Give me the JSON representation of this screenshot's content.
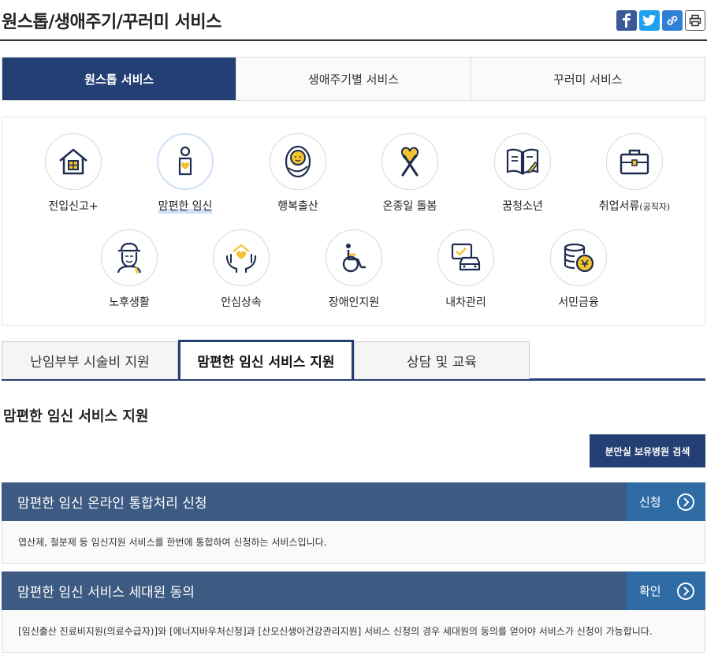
{
  "header": {
    "title": "원스톱/생애주기/꾸러미 서비스"
  },
  "share": [
    {
      "name": "facebook-icon",
      "cls": "fb"
    },
    {
      "name": "twitter-icon",
      "cls": "tw"
    },
    {
      "name": "link-icon",
      "cls": "lk"
    },
    {
      "name": "print-icon",
      "cls": "pr"
    }
  ],
  "main_tabs": [
    {
      "label": "원스톱 서비스",
      "active": true
    },
    {
      "label": "생애주기별 서비스",
      "active": false
    },
    {
      "label": "꾸러미 서비스",
      "active": false
    }
  ],
  "services": [
    {
      "label": "전입신고+",
      "icon": "house-icon"
    },
    {
      "label": "맘편한 임신",
      "icon": "pregnant-icon",
      "active": true
    },
    {
      "label": "행복출산",
      "icon": "baby-icon"
    },
    {
      "label": "온종일 돌봄",
      "icon": "ribbon-icon"
    },
    {
      "label": "꿈청소년",
      "icon": "book-icon"
    },
    {
      "label": "취업서류",
      "label_small": "(공직자)",
      "icon": "briefcase-icon"
    },
    {
      "label": "노후생활",
      "icon": "elder-icon"
    },
    {
      "label": "안심상속",
      "icon": "hands-heart-icon"
    },
    {
      "label": "장애인지원",
      "icon": "wheelchair-icon"
    },
    {
      "label": "내차관리",
      "icon": "car-icon"
    },
    {
      "label": "서민금융",
      "icon": "coins-icon"
    }
  ],
  "sub_tabs": [
    {
      "label": "난임부부 시술비 지원",
      "active": false
    },
    {
      "label": "맘편한 임신 서비스 지원",
      "active": true
    },
    {
      "label": "상담 및 교육",
      "active": false
    }
  ],
  "section": {
    "title": "맘편한 임신 서비스 지원",
    "search_button": "분만실 보유병원 검색"
  },
  "cards": [
    {
      "title": "맘편한 임신 온라인 통합처리 신청",
      "action": "신청",
      "desc": "엽산제, 철분제 등 임신지원 서비스를 한번에 통합하여 신청하는 서비스입니다."
    },
    {
      "title": "맘편한 임신 서비스 세대원 동의",
      "action": "확인",
      "desc": "[임신출산 진료비지원(의료수급자)]와 [에너지바우처신청]과 [산모신생아건강관리지원] 서비스 신청의 경우 세대원의 동의를 얻어야 서비스가 신청이 가능합니다."
    }
  ],
  "colors": {
    "navy": "#233f74",
    "bar": "#3d5a82",
    "action": "#2f6ca6",
    "gold": "#f2c230"
  }
}
